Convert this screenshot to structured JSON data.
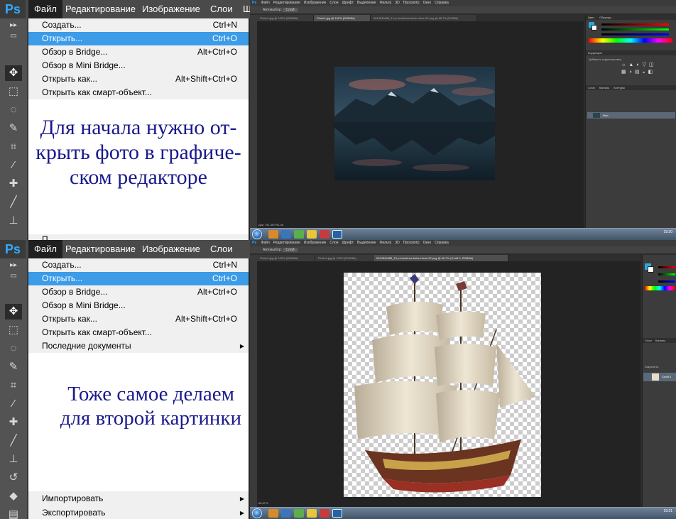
{
  "app": {
    "logo": "Ps"
  },
  "menubar": {
    "file": "Файл",
    "edit": "Редактирование",
    "image": "Изображение",
    "layers": "Слои",
    "type_cut": "Ш"
  },
  "file_menu_top": {
    "items": [
      {
        "label": "Создать...",
        "shortcut": "Ctrl+N"
      },
      {
        "label": "Открыть...",
        "shortcut": "Ctrl+O"
      },
      {
        "label": "Обзор в Bridge...",
        "shortcut": "Alt+Ctrl+O"
      },
      {
        "label": "Обзор в Mini Bridge...",
        "shortcut": ""
      },
      {
        "label": "Открыть как...",
        "shortcut": "Alt+Shift+Ctrl+O"
      },
      {
        "label": "Открыть как смарт-объект...",
        "shortcut": ""
      }
    ],
    "cut_item": "П"
  },
  "file_menu_bottom": {
    "items": [
      {
        "label": "Создать...",
        "shortcut": "Ctrl+N"
      },
      {
        "label": "Открыть...",
        "shortcut": "Ctrl+O"
      },
      {
        "label": "Обзор в Bridge...",
        "shortcut": "Alt+Ctrl+O"
      },
      {
        "label": "Обзор в Mini Bridge...",
        "shortcut": ""
      },
      {
        "label": "Открыть как...",
        "shortcut": "Alt+Shift+Ctrl+O"
      },
      {
        "label": "Открыть как смарт-объект...",
        "shortcut": ""
      },
      {
        "label": "Последние документы",
        "shortcut": ""
      }
    ],
    "lower_items": [
      {
        "label": "Импортировать"
      },
      {
        "label": "Экспортировать"
      }
    ]
  },
  "captions": {
    "top_line1": "Для начала нужно от-",
    "top_line2": "крыть фото в графиче-",
    "top_line3": "ском редакторе",
    "bottom_line1": "Тоже самое делаем",
    "bottom_line2": "для второй картинки"
  },
  "screen_top": {
    "menubar": [
      "Файл",
      "Редактирование",
      "Изображение",
      "Слои",
      "Шрифт",
      "Выделение",
      "Фильтр",
      "3D",
      "Просмотр",
      "Окно",
      "Справка"
    ],
    "options_label": "Автовыбор:",
    "options_value": "Слой",
    "tabs": [
      "Photo1.jpg @ 100% (RGB/8#)",
      "Photo1.jpg @ 100% (RGB/8#)",
      "2614540485_12-p-korabl-na-belom-fone-22.png @ 66,7% (RGB/8)"
    ],
    "tooltip": "Photo1.jpg @ 100% (RGB/8#)",
    "color_panel": "Цвет",
    "swatches_panel": "Образцы",
    "corrections_panel": "Коррекция",
    "corrections_sub": "Добавить корректировку",
    "layers_tabs": [
      "Слои",
      "Каналы",
      "Контуры"
    ],
    "layer_name": "Фон",
    "status": "Док: 791,4K/791,4K",
    "clock": "19:20"
  },
  "screen_bottom": {
    "menubar": [
      "Файл",
      "Редактирование",
      "Изображение",
      "Слои",
      "Шрифт",
      "Выделение",
      "Фильтр",
      "3D",
      "Просмотр",
      "Окно",
      "Справка"
    ],
    "options_label": "Автовыбор:",
    "options_value": "Слой",
    "tabs": [
      "Photo1.jpg @ 100% (RGB/8#)",
      "Photo1.jpg @ 100% (RGB/8#)",
      "2614540485_12-p-korabl-na-belom-fone-22.png @ 66,7% (Слой 0, RGB/8#)"
    ],
    "layers_tabs": [
      "Слои",
      "Каналы"
    ],
    "layer_name": "Слой 0",
    "opacity_label": "Закрепить:",
    "zoom": "66,67%",
    "clock": "19:21"
  },
  "colors": {
    "accent": "#3c9ce8",
    "caption": "#1a1a8c",
    "menubar": "#4a4a4a"
  }
}
